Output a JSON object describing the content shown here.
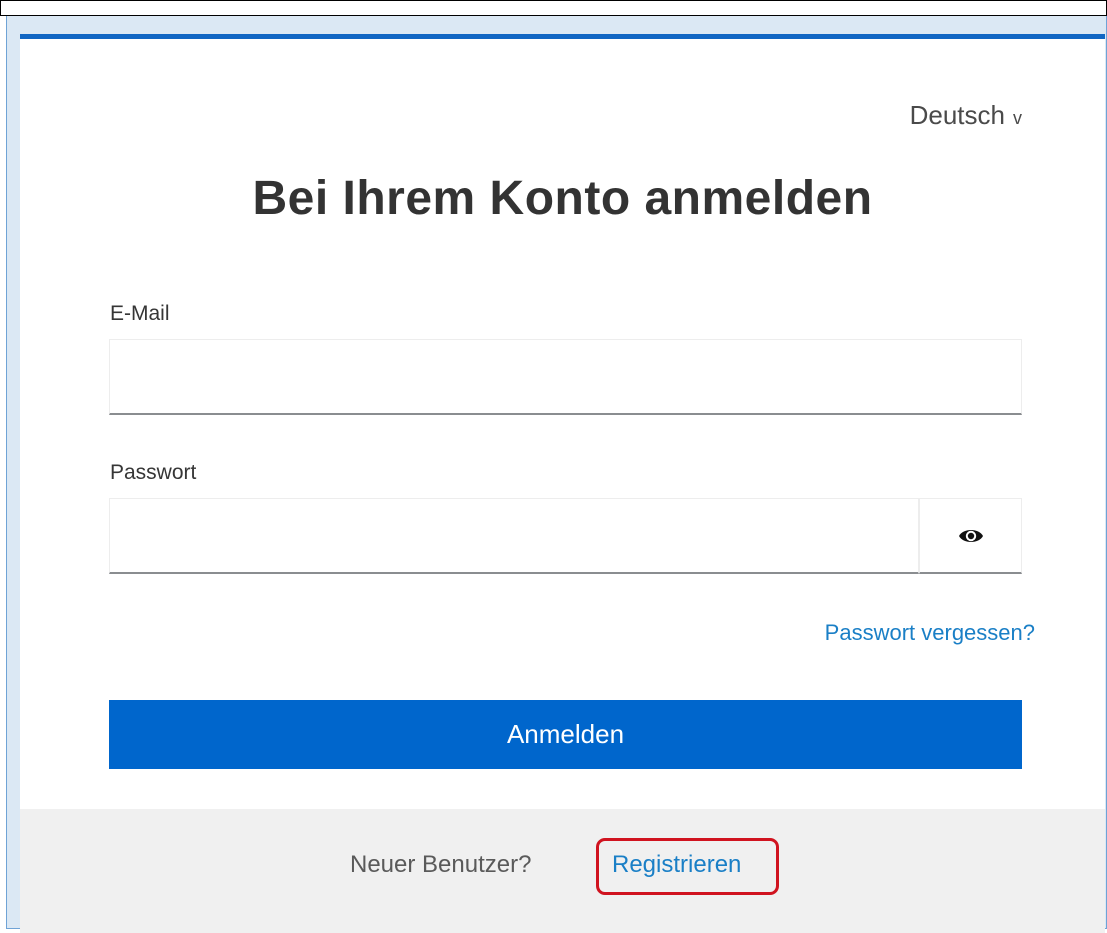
{
  "language": {
    "selected": "Deutsch",
    "chevron": "v"
  },
  "page": {
    "title": "Bei Ihrem Konto anmelden"
  },
  "form": {
    "email_label": "E-Mail",
    "email_value": "",
    "password_label": "Passwort",
    "password_value": "",
    "show_password_icon": "eye-icon",
    "forgot_password": "Passwort vergessen?",
    "submit_label": "Anmelden"
  },
  "footer": {
    "new_user_text": "Neuer Benutzer?",
    "register_link": "Registrieren"
  },
  "colors": {
    "accent": "#0066cc",
    "link": "#1a7fc6",
    "top_border": "#1166c3",
    "highlight": "#d0131f",
    "footer_bg": "#f0f0f0"
  }
}
